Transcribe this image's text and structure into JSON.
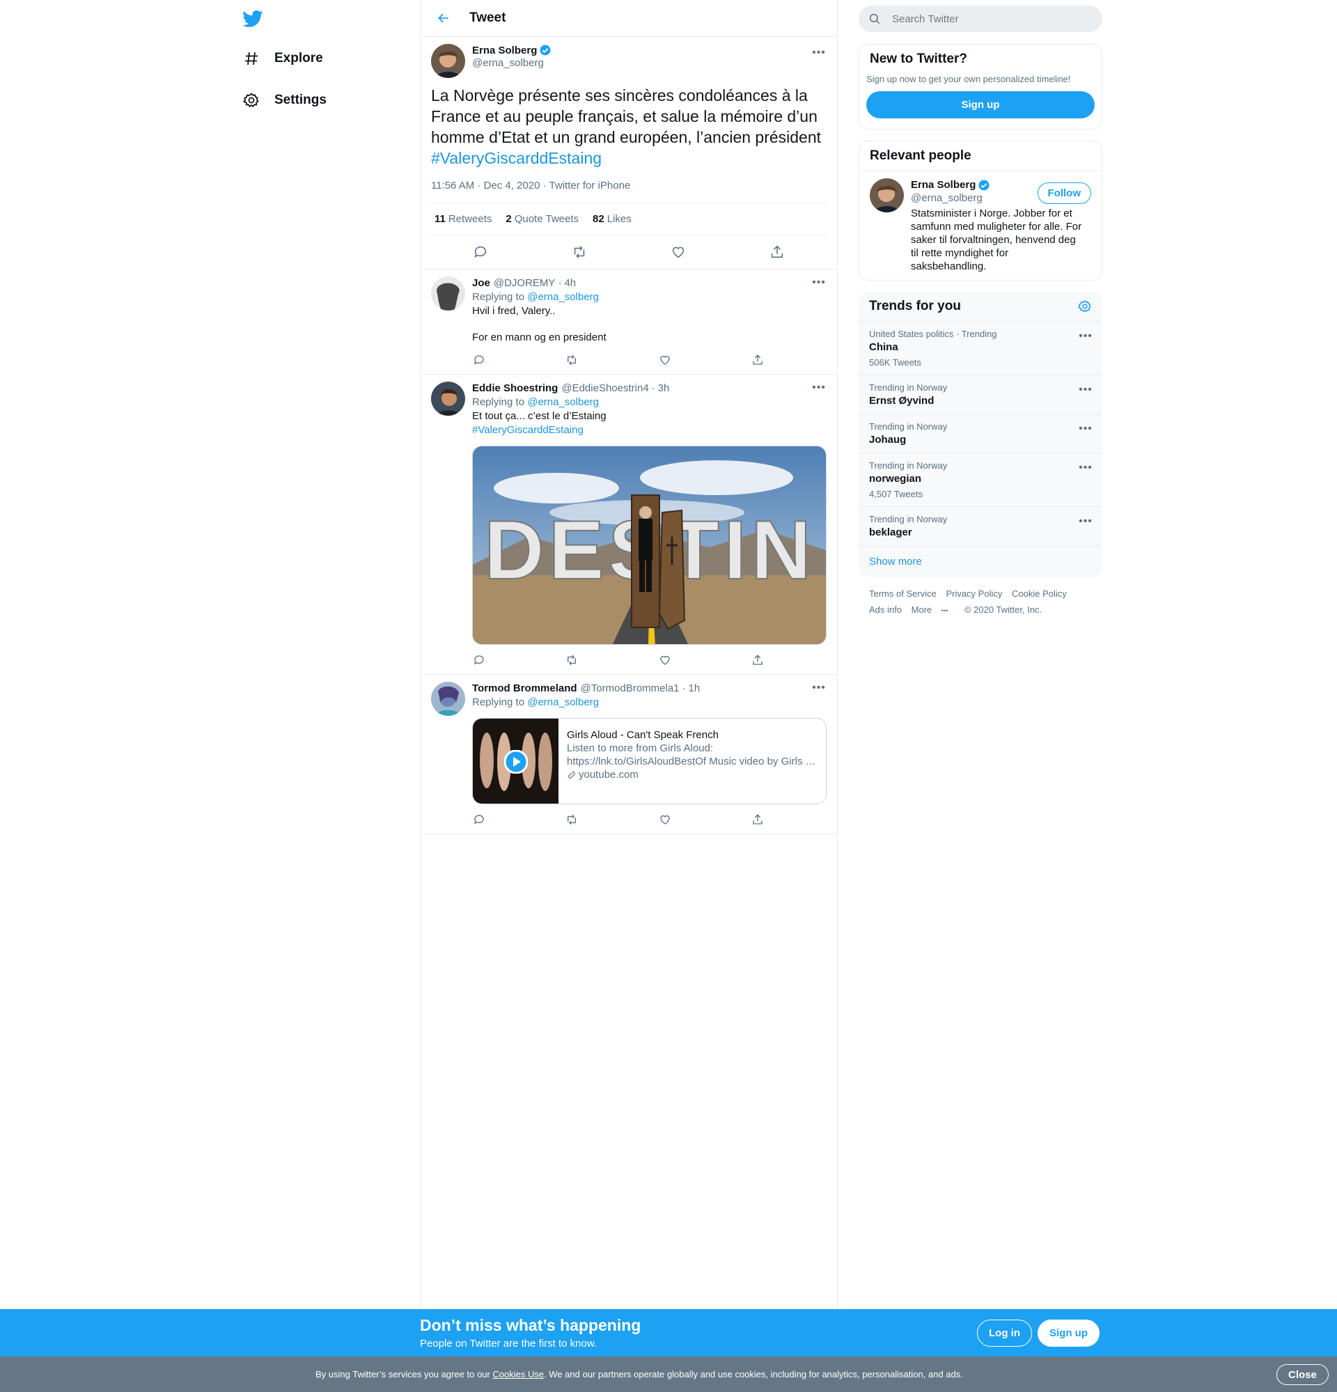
{
  "nav": {
    "explore": "Explore",
    "settings": "Settings"
  },
  "header": {
    "title": "Tweet"
  },
  "main_tweet": {
    "name": "Erna Solberg",
    "handle": "@erna_solberg",
    "text": "La Norvège présente ses sincères condoléances à la France et au peuple français, et salue la mémoire d’un homme d’Etat et un grand européen, l’ancien président",
    "hashtag": "#ValeryGiscarddEstaing",
    "meta": "11:56 AM · Dec 4, 2020 · Twitter for iPhone",
    "retweets": "11",
    "retweets_label": "Retweets",
    "quotes": "2",
    "quotes_label": "Quote Tweets",
    "likes": "82",
    "likes_label": "Likes"
  },
  "replies": [
    {
      "name": "Joe",
      "handle": "@DJOREMY",
      "time": "4h",
      "replying_label": "Replying to",
      "replying_to": "@erna_solberg",
      "line1": "Hvil i fred, Valery..",
      "line2": "For en mann og en president"
    },
    {
      "name": "Eddie Shoestring",
      "handle": "@EddieShoestrin4",
      "time": "3h",
      "replying_label": "Replying to",
      "replying_to": "@erna_solberg",
      "line1": "Et tout ça... c’est le d’Estaing",
      "hashtag": "#ValeryGiscarddEstaing",
      "image_text": "DESTIN"
    },
    {
      "name": "Tormod Brommeland",
      "handle": "@TormodBrommela1",
      "time": "1h",
      "replying_label": "Replying to",
      "replying_to": "@erna_solberg",
      "card": {
        "title": "Girls Aloud - Can't Speak French",
        "desc1": "Listen to more from Girls Aloud:",
        "desc2": "https://lnk.to/GirlsAloudBestOf Music video by Girls …",
        "domain": "youtube.com"
      }
    }
  ],
  "search": {
    "placeholder": "Search Twitter"
  },
  "new_to_twitter": {
    "title": "New to Twitter?",
    "text": "Sign up now to get your own personalized timeline!",
    "button": "Sign up"
  },
  "relevant": {
    "title": "Relevant people",
    "name": "Erna Solberg",
    "handle": "@erna_solberg",
    "follow": "Follow",
    "bio": "Statsminister i Norge. Jobber for et samfunn med muligheter for alle. For saker til forvaltningen, henvend deg til rette myndighet for saksbehandling."
  },
  "trends": {
    "title": "Trends for you",
    "items": [
      {
        "context": "United States politics · Trending",
        "topic": "China",
        "count": "506K Tweets"
      },
      {
        "context": "Trending in Norway",
        "topic": "Ernst Øyvind",
        "count": ""
      },
      {
        "context": "Trending in Norway",
        "topic": "Johaug",
        "count": ""
      },
      {
        "context": "Trending in Norway",
        "topic": "norwegian",
        "count": "4,507 Tweets"
      },
      {
        "context": "Trending in Norway",
        "topic": "beklager",
        "count": ""
      }
    ],
    "show_more": "Show more"
  },
  "footer": {
    "terms": "Terms of Service",
    "privacy": "Privacy Policy",
    "cookie": "Cookie Policy",
    "ads": "Ads info",
    "more": "More",
    "copyright": "© 2020 Twitter, Inc."
  },
  "banner": {
    "title": "Don’t miss what’s happening",
    "subtitle": "People on Twitter are the first to know.",
    "login": "Log in",
    "signup": "Sign up"
  },
  "cookie": {
    "pre": "By using Twitter’s services you agree to our ",
    "link": "Cookies Use",
    "post": ". We and our partners operate globally and use cookies, including for analytics, personalisation, and ads.",
    "close": "Close"
  },
  "colors": {
    "accent": "#1da1f2",
    "link": "#1b95e0",
    "secondary_text": "#5b7083",
    "cookie_bar": "#657786"
  },
  "icons": [
    "twitter-logo-icon",
    "hashtag-icon",
    "gear-icon",
    "back-arrow-icon",
    "verified-badge-icon",
    "more-dots-icon",
    "reply-icon",
    "retweet-icon",
    "like-icon",
    "share-icon",
    "search-icon",
    "link-icon",
    "play-icon"
  ]
}
